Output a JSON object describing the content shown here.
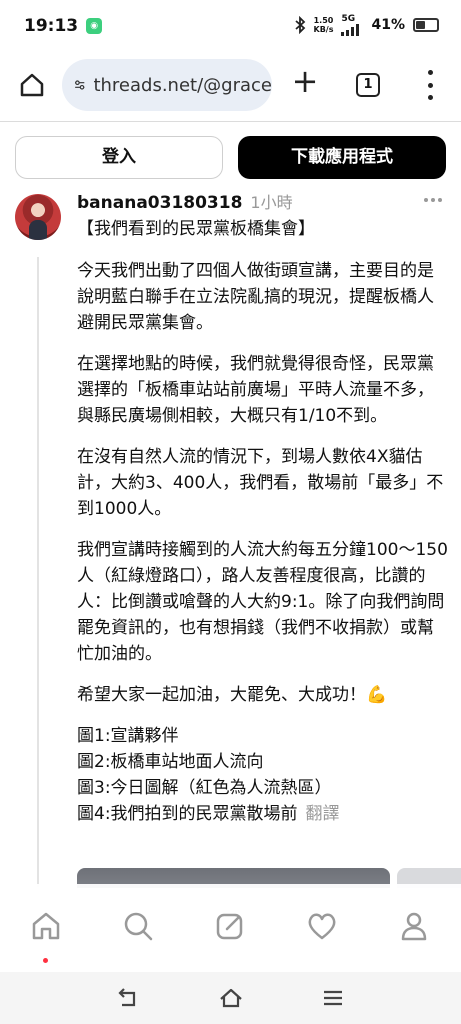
{
  "status_bar": {
    "time": "19:13",
    "net_speed_value": "1.50",
    "net_speed_unit": "KB/s",
    "network": "5G",
    "battery": "41%",
    "battery_level": 0.41
  },
  "browser": {
    "url": "threads.net/@grace",
    "tab_count": "1"
  },
  "threads_header": {
    "login_label": "登入",
    "download_label": "下載應用程式"
  },
  "post": {
    "username": "banana03180318",
    "time": "1小時",
    "title": "【我們看到的民眾黨板橋集會】",
    "paragraphs": [
      "今天我們出動了四個人做街頭宣講，主要目的是說明藍白聯手在立法院亂搞的現況，提醒板橋人避開民眾黨集會。",
      "在選擇地點的時候，我們就覺得很奇怪，民眾黨選擇的「板橋車站站前廣場」平時人流量不多，與縣民廣場側相較，大概只有1/10不到。",
      "在沒有自然人流的情況下，到場人數依4X貓估計，大約3、400人，我們看，散場前「最多」不到1000人。",
      "我們宣講時接觸到的人流大約每五分鐘100～150人（紅綠燈路口），路人友善程度很高，比讚的人：比倒讚或嗆聲的人大約9:1。除了向我們詢問罷免資訊的，也有想捐錢（我們不收捐款）或幫忙加油的。",
      "希望大家一起加油，大罷免、大成功！💪"
    ],
    "figures": [
      "圖1:宣講夥伴",
      "圖2:板橋車站地面人流向",
      "圖3:今日圖解（紅色為人流熱區）",
      "圖4:我們拍到的民眾黨散場前"
    ],
    "translate_label": "翻譯"
  },
  "bottom_nav": [
    "home-icon",
    "search-icon",
    "compose-icon",
    "heart-icon",
    "profile-icon"
  ],
  "system_nav": [
    "back-icon",
    "home-icon",
    "recents-icon"
  ]
}
